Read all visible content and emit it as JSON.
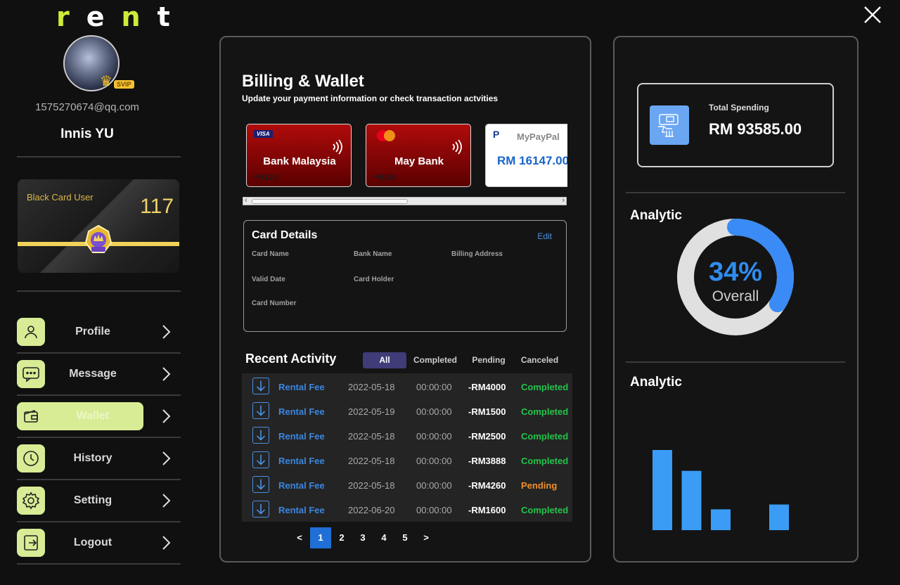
{
  "app": {
    "logo": "rent"
  },
  "user": {
    "email": "1575270674@qq.com",
    "name": "Innis YU",
    "badge": "SVIP"
  },
  "black_card": {
    "label": "Black Card User",
    "number": "117"
  },
  "nav": [
    {
      "label": "Profile",
      "icon": "user-icon"
    },
    {
      "label": "Message",
      "icon": "chat-icon"
    },
    {
      "label": "Wallet",
      "icon": "wallet-icon",
      "active": true
    },
    {
      "label": "History",
      "icon": "clock-icon"
    },
    {
      "label": "Setting",
      "icon": "gear-icon"
    },
    {
      "label": "Logout",
      "icon": "logout-icon"
    }
  ],
  "billing": {
    "title": "Billing & Wallet",
    "subtitle": "Update your payment information or check transaction actvities",
    "cards": [
      {
        "name": "Bank Malaysia",
        "last4": "**9123",
        "brand": "VISA"
      },
      {
        "name": "May Bank",
        "last4": "**0159",
        "brand": "mastercard"
      },
      {
        "brand": "PayPal",
        "name": "MyPayPal",
        "amount": "RM 16147.00"
      }
    ]
  },
  "card_details": {
    "title": "Card Details",
    "edit": "Edit",
    "fields": [
      "Card Name",
      "Bank Name",
      "Billing Address",
      "Valid Date",
      "Card Holder",
      "Card Number"
    ]
  },
  "activity": {
    "title": "Recent Activity",
    "tabs": [
      "All",
      "Completed",
      "Pending",
      "Canceled"
    ],
    "rows": [
      {
        "type": "Rental Fee",
        "date": "2022-05-18",
        "time": "00:00:00",
        "amount": "-RM4000",
        "status": "Completed"
      },
      {
        "type": "Rental Fee",
        "date": "2022-05-19",
        "time": "00:00:00",
        "amount": "-RM1500",
        "status": "Completed"
      },
      {
        "type": "Rental Fee",
        "date": "2022-05-18",
        "time": "00:00:00",
        "amount": "-RM2500",
        "status": "Completed"
      },
      {
        "type": "Rental Fee",
        "date": "2022-05-18",
        "time": "00:00:00",
        "amount": "-RM3888",
        "status": "Completed"
      },
      {
        "type": "Rental Fee",
        "date": "2022-05-18",
        "time": "00:00:00",
        "amount": "-RM4260",
        "status": "Pending"
      },
      {
        "type": "Rental Fee",
        "date": "2022-06-20",
        "time": "00:00:00",
        "amount": "-RM1600",
        "status": "Completed"
      }
    ],
    "pager": [
      "<",
      "1",
      "2",
      "3",
      "4",
      "5",
      ">"
    ],
    "current_page": "1"
  },
  "summary": {
    "spend_label": "Total Spending",
    "spend_value": "RM 93585.00",
    "analytic1_title": "Analytic",
    "donut_pct": "34%",
    "donut_label": "Overall",
    "donut_fraction": 0.34,
    "analytic2_title": "Analytic",
    "bar_values": [
      100,
      74,
      26,
      0,
      32
    ]
  },
  "colors": {
    "accent": "#d8ec95",
    "logo_green": "#cdeb3a",
    "blue": "#3b86e0",
    "completed": "#22c44a",
    "pending": "#f0902a"
  }
}
